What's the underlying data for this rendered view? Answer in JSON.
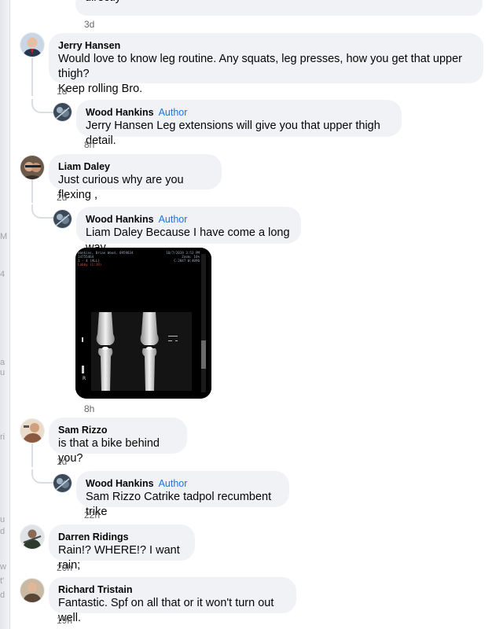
{
  "top_comment": {
    "text": "directly",
    "time": "3d"
  },
  "author_label": "Author",
  "comments": [
    {
      "name": "Jerry Hansen",
      "text_line1": "Would love to know leg routine. Any squats, leg presses, how you get that upper thigh?",
      "text_line2": "Keep rolling Bro.",
      "time": "1d",
      "reply": {
        "name": "Wood Hankins",
        "text": "Jerry Hansen Leg extensions will give you that upper thigh detail.",
        "time": "8h"
      }
    },
    {
      "name": "Liam Daley",
      "text": "Just curious why are you flexing ,",
      "time": "2d",
      "reply": {
        "name": "Wood Hankins",
        "text": "Liam Daley Because I have come a long way",
        "time": "8h"
      }
    },
    {
      "name": "Sam Rizzo",
      "text": "is that a bike behind you?",
      "time": "1d",
      "reply": {
        "name": "Wood Hankins",
        "text": "Sam Rizzo Catrike tadpol recumbent trike",
        "time": "22h"
      }
    },
    {
      "name": "Darren Ridings",
      "text": "Rain!? WHERE!? I want rain;",
      "time": "20h"
    },
    {
      "name": "Richard Tristain",
      "text": "Fantastic. Spf on all that or it won't turn out well.",
      "time": "19h"
    }
  ],
  "xray": {
    "header_left_1": "Hankins, Brian Wood, 0959834",
    "header_left_2": "14755464",
    "header_left_3": "1 - 4 (ALL)",
    "header_left_4": "Lobby (1:19)",
    "header_right_1": "10/7/2019 3:53 PM",
    "header_right_2": "Zoom: 16%",
    "header_right_3": "C:2047 W:4096",
    "marker": "R"
  },
  "colors": {
    "bubble": "#f0f2f5",
    "author": "#1b74e4",
    "meta": "#65676b",
    "thread": "#dadde1"
  }
}
